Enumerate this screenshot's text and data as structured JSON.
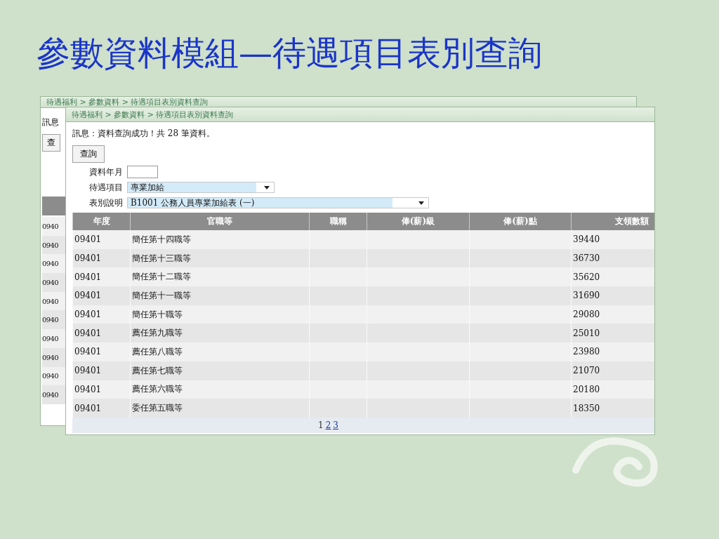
{
  "slide_title": "參數資料模組—待遇項目表別查詢",
  "back_window": {
    "breadcrumb": "待遇福利 > 參數資料 > 待遇項目表別資料查詢",
    "message": "訊息",
    "query_button": "查",
    "rows": [
      "0940",
      "0940",
      "0940",
      "0940",
      "0940",
      "0940",
      "0940",
      "0940",
      "0940",
      "0940"
    ]
  },
  "window": {
    "breadcrumb": "待遇福利 > 參數資料 > 待遇項目表別資料查詢",
    "message": "訊息：資料查詢成功！共 28 筆資料。",
    "query_button": "查詢",
    "form": [
      {
        "label": "資料年月",
        "kind": "text"
      },
      {
        "label": "待遇項目",
        "kind": "select",
        "value": "專業加給"
      },
      {
        "label": "表別說明",
        "kind": "select",
        "value": "B1001 公務人員專業加給表 (一)"
      }
    ],
    "table": {
      "columns": [
        "年度",
        "官職等",
        "職稱",
        "俸(薪)級",
        "俸(薪)點",
        "支領數額"
      ],
      "rows": [
        [
          "09401",
          "簡任第十四職等",
          "",
          "",
          "",
          "39440"
        ],
        [
          "09401",
          "簡任第十三職等",
          "",
          "",
          "",
          "36730"
        ],
        [
          "09401",
          "簡任第十二職等",
          "",
          "",
          "",
          "35620"
        ],
        [
          "09401",
          "簡任第十一職等",
          "",
          "",
          "",
          "31690"
        ],
        [
          "09401",
          "簡任第十職等",
          "",
          "",
          "",
          "29080"
        ],
        [
          "09401",
          "薦任第九職等",
          "",
          "",
          "",
          "25010"
        ],
        [
          "09401",
          "薦任第八職等",
          "",
          "",
          "",
          "23980"
        ],
        [
          "09401",
          "薦任第七職等",
          "",
          "",
          "",
          "21070"
        ],
        [
          "09401",
          "薦任第六職等",
          "",
          "",
          "",
          "20180"
        ],
        [
          "09401",
          "委任第五職等",
          "",
          "",
          "",
          "18350"
        ]
      ]
    },
    "pager": [
      {
        "label": "1",
        "selected": true
      },
      {
        "label": "2",
        "selected": false
      },
      {
        "label": "3",
        "selected": false
      }
    ]
  }
}
